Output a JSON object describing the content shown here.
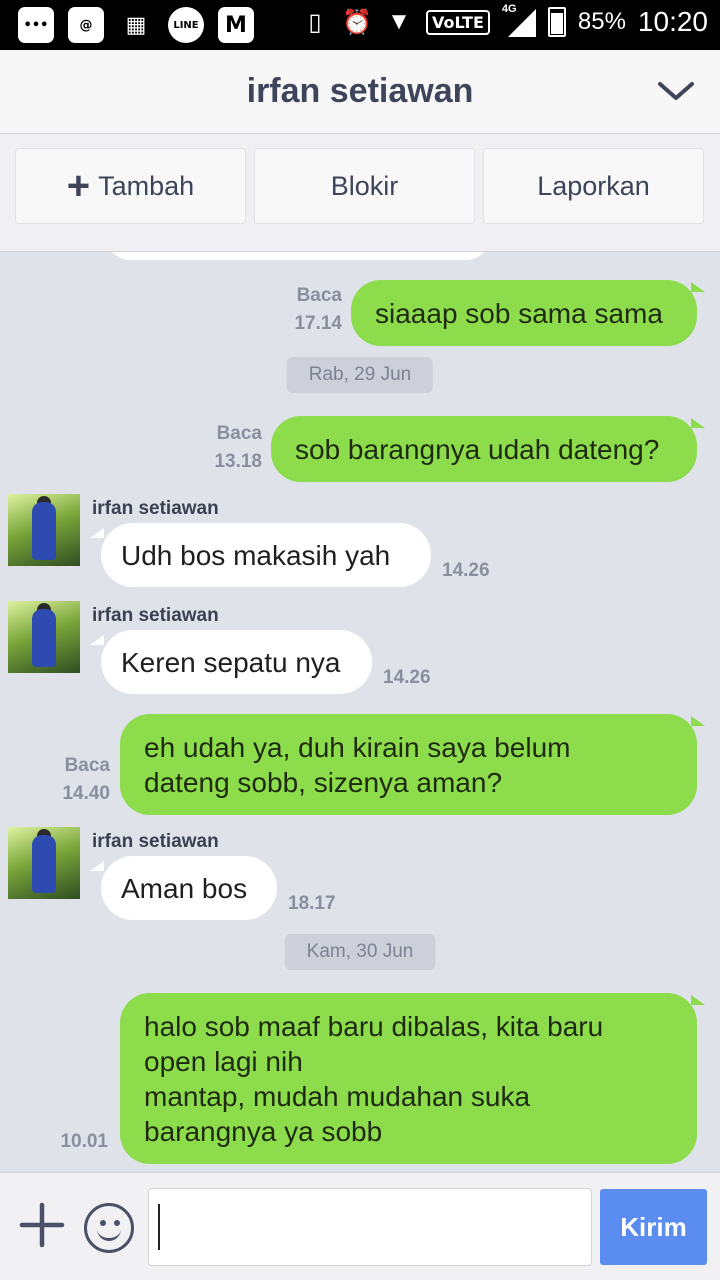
{
  "status_bar": {
    "battery": "85%",
    "time": "10:20",
    "network": "4G",
    "volte": "VoLTE",
    "app_icons": [
      "more-icon",
      "email-icon",
      "bbm-icon",
      "line-icon",
      "gmail-icon"
    ]
  },
  "header": {
    "title": "irfan setiawan"
  },
  "actions": {
    "add_label": "Tambah",
    "block_label": "Blokir",
    "report_label": "Laporkan"
  },
  "chat": {
    "messages": [
      {
        "side": "out",
        "text": "siaaap sob sama sama",
        "read": "Baca",
        "time": "17.14"
      },
      {
        "type": "date",
        "text": "Rab, 29 Jun"
      },
      {
        "side": "out",
        "text": "sob barangnya udah dateng?",
        "read": "Baca",
        "time": "13.18"
      },
      {
        "side": "in",
        "sender": "irfan setiawan",
        "text": "Udh bos makasih yah",
        "time": "14.26"
      },
      {
        "side": "in",
        "sender": "irfan setiawan",
        "text": "Keren sepatu nya",
        "time": "14.26"
      },
      {
        "side": "out",
        "text": "eh udah ya, duh kirain saya belum\ndateng sobb, sizenya aman?",
        "read": "Baca",
        "time": "14.40"
      },
      {
        "side": "in",
        "sender": "irfan setiawan",
        "text": "Aman bos",
        "time": "18.17"
      },
      {
        "type": "date",
        "text": "Kam, 30 Jun"
      },
      {
        "side": "out",
        "text": "halo sob maaf baru dibalas, kita baru\nopen lagi nih\nmantap, mudah mudahan suka\nbarangnya ya sobb",
        "time": "10.01"
      }
    ]
  },
  "composer": {
    "input_value": "",
    "send_label": "Kirim"
  }
}
